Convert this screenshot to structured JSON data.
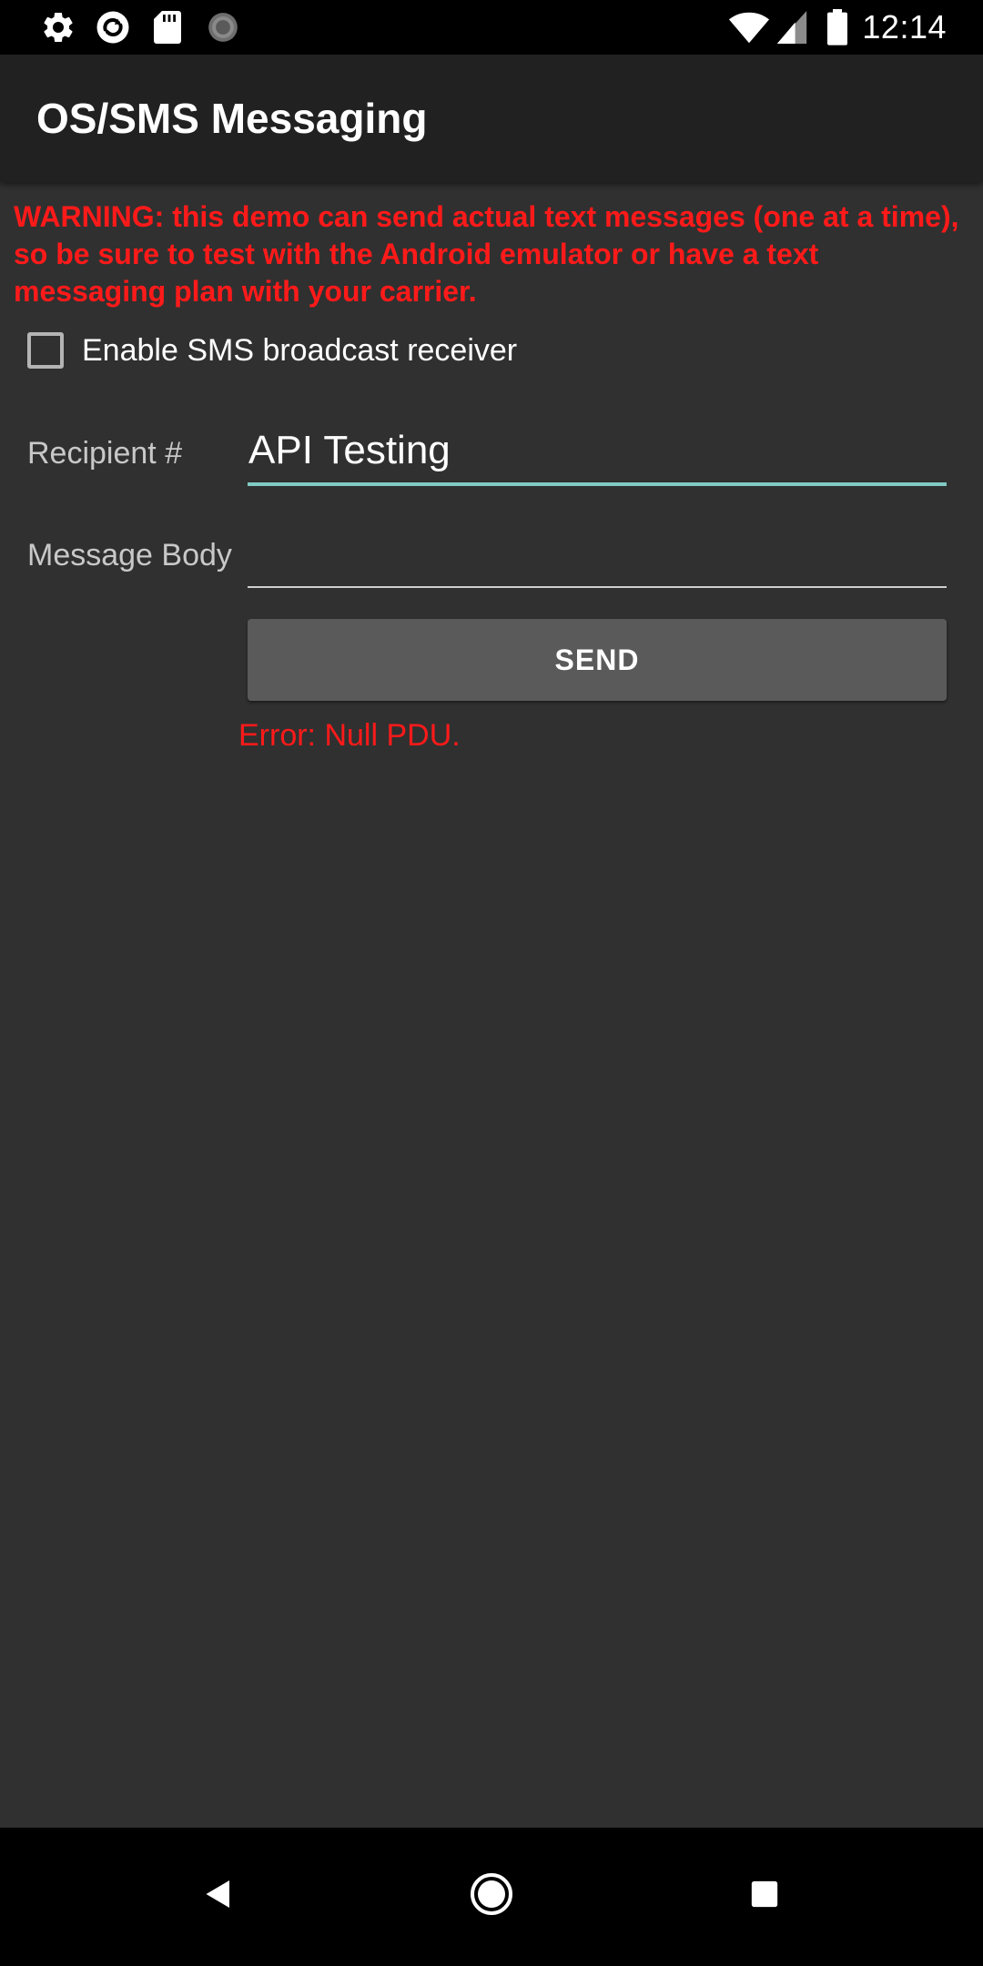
{
  "status_bar": {
    "left_icons": [
      "settings-gear-icon",
      "sync-icon",
      "sd-card-icon",
      "loading-spinner-icon"
    ],
    "right_icons": [
      "wifi-icon",
      "cell-signal-icon",
      "battery-icon"
    ],
    "time": "12:14"
  },
  "app_bar": {
    "title": "OS/SMS Messaging"
  },
  "content": {
    "warning": "WARNING: this demo can send actual text messages (one at a time), so be sure to test with the Android emulator or have a text messaging plan with your carrier.",
    "sms_receiver_checkbox": {
      "label": "Enable SMS broadcast receiver",
      "checked": false
    },
    "recipient": {
      "label": "Recipient #",
      "value": "API Testing"
    },
    "message_body": {
      "label": "Message Body",
      "value": ""
    },
    "send_button_label": "SEND",
    "error": "Error: Null PDU."
  },
  "nav_bar": {
    "buttons": [
      "back-icon",
      "home-icon",
      "recents-icon"
    ]
  },
  "colors": {
    "warning_red": "#ff1a1a",
    "focus_teal": "#80cbc4",
    "background": "#303030",
    "app_bar": "#212121"
  }
}
